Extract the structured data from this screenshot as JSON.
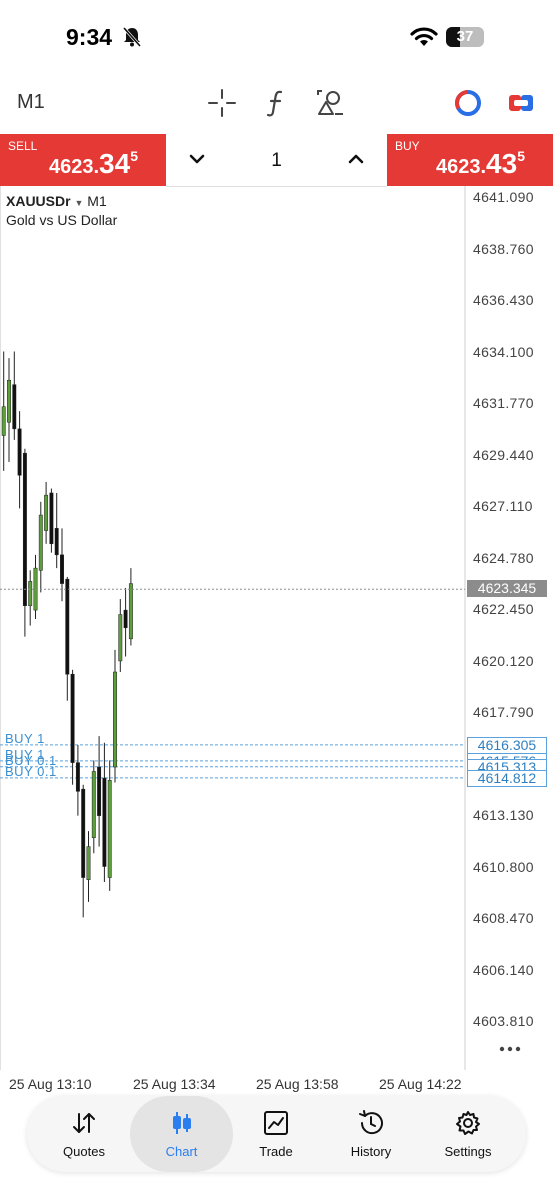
{
  "status_bar": {
    "time": "9:34",
    "battery": "37",
    "battery_level": 0.37
  },
  "toolbar": {
    "timeframe": "M1"
  },
  "trade": {
    "sell": {
      "label": "SELL",
      "price_main": "4623.",
      "price_big": "34",
      "price_sup": "5"
    },
    "buy": {
      "label": "BUY",
      "price_main": "4623.",
      "price_big": "43",
      "price_sup": "5"
    },
    "lot": "1"
  },
  "chart": {
    "symbol": "XAUUSDr",
    "symbol_timeframe": "M1",
    "description": "Gold vs US Dollar",
    "current_price": "4623.345",
    "price_labels": [
      "4641.090",
      "4638.760",
      "4636.430",
      "4634.100",
      "4631.770",
      "4629.440",
      "4627.110",
      "4624.780",
      "4622.450",
      "4620.120",
      "4617.790",
      "4613.130",
      "4610.800",
      "4608.470",
      "4606.140",
      "4603.810"
    ],
    "orders": [
      {
        "label": "BUY 1",
        "price": "4616.305"
      },
      {
        "label": "BUY 1",
        "price": "4615.576"
      },
      {
        "label": "BUY 0.1",
        "price": "4615.313"
      },
      {
        "label": "BUY 0.1",
        "price": "4614.812"
      }
    ],
    "time_labels": [
      "25 Aug 13:10",
      "25 Aug 13:34",
      "25 Aug 13:58",
      "25 Aug 14:22"
    ]
  },
  "chart_data": {
    "type": "candlestick",
    "symbol": "XAUUSDr",
    "timeframe": "M1",
    "ylim": [
      4602.6,
      4642.2
    ],
    "x_ticks": [
      "25 Aug 13:10",
      "25 Aug 13:34",
      "25 Aug 13:58",
      "25 Aug 14:22"
    ],
    "candles": [
      {
        "o": 4630.3,
        "h": 4634.1,
        "l": 4628.7,
        "c": 4631.6,
        "dir": "up"
      },
      {
        "o": 4630.9,
        "h": 4633.8,
        "l": 4629.1,
        "c": 4632.8,
        "dir": "up"
      },
      {
        "o": 4632.6,
        "h": 4634.1,
        "l": 4630.1,
        "c": 4630.6,
        "dir": "down"
      },
      {
        "o": 4630.6,
        "h": 4631.4,
        "l": 4627.0,
        "c": 4628.5,
        "dir": "down"
      },
      {
        "o": 4629.5,
        "h": 4629.7,
        "l": 4621.2,
        "c": 4622.6,
        "dir": "down"
      },
      {
        "o": 4622.6,
        "h": 4624.2,
        "l": 4621.7,
        "c": 4623.7,
        "dir": "up"
      },
      {
        "o": 4622.4,
        "h": 4624.9,
        "l": 4622.0,
        "c": 4624.3,
        "dir": "up"
      },
      {
        "o": 4624.2,
        "h": 4627.3,
        "l": 4623.2,
        "c": 4626.7,
        "dir": "up"
      },
      {
        "o": 4626.0,
        "h": 4628.2,
        "l": 4625.4,
        "c": 4627.6,
        "dir": "up"
      },
      {
        "o": 4627.7,
        "h": 4627.9,
        "l": 4625.0,
        "c": 4625.4,
        "dir": "down"
      },
      {
        "o": 4626.1,
        "h": 4627.7,
        "l": 4624.3,
        "c": 4624.9,
        "dir": "down"
      },
      {
        "o": 4624.9,
        "h": 4626.1,
        "l": 4622.8,
        "c": 4623.6,
        "dir": "down"
      },
      {
        "o": 4623.8,
        "h": 4623.9,
        "l": 4618.3,
        "c": 4619.5,
        "dir": "down"
      },
      {
        "o": 4619.5,
        "h": 4619.7,
        "l": 4614.5,
        "c": 4615.5,
        "dir": "down"
      },
      {
        "o": 4615.5,
        "h": 4616.3,
        "l": 4613.1,
        "c": 4614.2,
        "dir": "down"
      },
      {
        "o": 4614.3,
        "h": 4614.5,
        "l": 4608.5,
        "c": 4610.3,
        "dir": "down"
      },
      {
        "o": 4610.2,
        "h": 4612.4,
        "l": 4609.2,
        "c": 4611.7,
        "dir": "up"
      },
      {
        "o": 4612.1,
        "h": 4615.6,
        "l": 4611.4,
        "c": 4615.1,
        "dir": "up"
      },
      {
        "o": 4615.3,
        "h": 4616.7,
        "l": 4611.7,
        "c": 4613.1,
        "dir": "down"
      },
      {
        "o": 4614.8,
        "h": 4616.4,
        "l": 4610.1,
        "c": 4610.8,
        "dir": "down"
      },
      {
        "o": 4610.3,
        "h": 4615.6,
        "l": 4609.7,
        "c": 4614.7,
        "dir": "up"
      },
      {
        "o": 4615.3,
        "h": 4620.6,
        "l": 4614.6,
        "c": 4619.6,
        "dir": "up"
      },
      {
        "o": 4620.1,
        "h": 4622.9,
        "l": 4619.6,
        "c": 4622.2,
        "dir": "up"
      },
      {
        "o": 4622.4,
        "h": 4623.4,
        "l": 4620.3,
        "c": 4621.6,
        "dir": "down"
      },
      {
        "o": 4621.1,
        "h": 4624.3,
        "l": 4620.8,
        "c": 4623.6,
        "dir": "up"
      }
    ],
    "horizontal_lines": [
      {
        "label": "BUY 1",
        "value": 4616.305
      },
      {
        "label": "BUY 1",
        "value": 4615.576
      },
      {
        "label": "BUY 0.1",
        "value": 4615.313
      },
      {
        "label": "BUY 0.1",
        "value": 4614.812
      },
      {
        "label": "Current",
        "value": 4623.345
      }
    ],
    "colors": {
      "bull": "#5d9e3c",
      "bear": "#111111",
      "order_line": "#5aa2df",
      "price_line": "#8c8c8c"
    }
  },
  "nav": {
    "items": [
      {
        "label": "Quotes",
        "icon": "quotes-arrows-icon",
        "active": false
      },
      {
        "label": "Chart",
        "icon": "chart-candles-icon",
        "active": true
      },
      {
        "label": "Trade",
        "icon": "trade-chart-icon",
        "active": false
      },
      {
        "label": "History",
        "icon": "history-clock-icon",
        "active": false
      },
      {
        "label": "Settings",
        "icon": "settings-gear-icon",
        "active": false
      }
    ]
  },
  "colors": {
    "sell": "#e53935",
    "buy": "#e53935",
    "accent": "#2a7ef0"
  }
}
